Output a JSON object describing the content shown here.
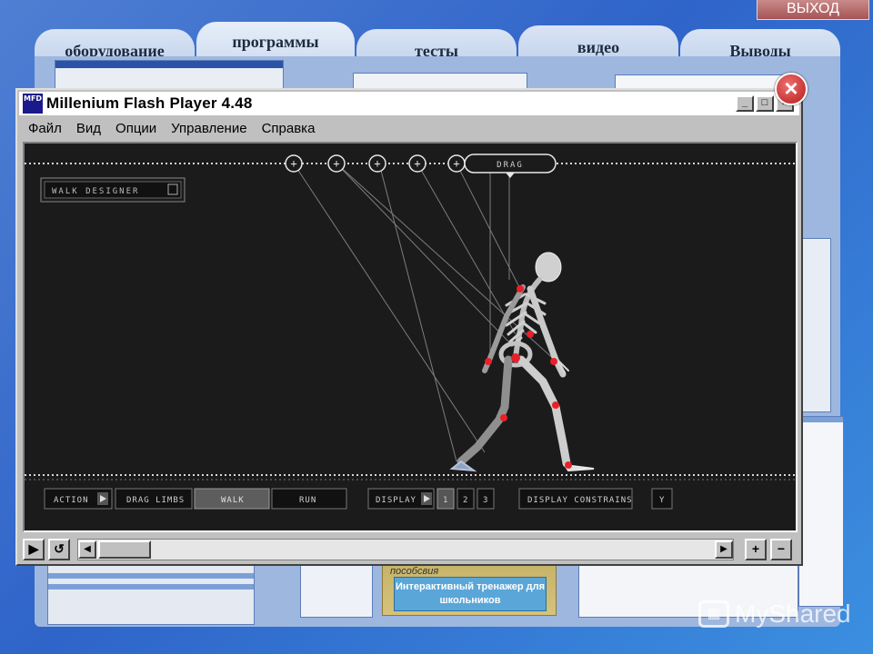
{
  "exit": {
    "label": "ВЫХОД"
  },
  "tabs": [
    {
      "label": "оборудование"
    },
    {
      "label": "программы"
    },
    {
      "label": "тесты"
    },
    {
      "label": "видео"
    },
    {
      "label": "Выводы"
    }
  ],
  "window": {
    "icon_text": "MFD",
    "title": "Millenium Flash Player 4.48",
    "minimize": "_",
    "maximize": "□",
    "close": "×",
    "menu": [
      "Файл",
      "Вид",
      "Опции",
      "Управление",
      "Справка"
    ]
  },
  "stage": {
    "designer_label": "WALK DESIGNER",
    "drag_label": "DRAG",
    "controls": {
      "action": "ACTION",
      "drag_limbs": "DRAG LIMBS",
      "walk": "WALK",
      "run": "RUN",
      "display": "DISPLAY",
      "display_1": "1",
      "display_2": "2",
      "display_3": "3",
      "display_constrains": "DISPLAY CONSTRAINS",
      "y": "Y"
    }
  },
  "bottombar": {
    "play": "▶",
    "rewind": "↺",
    "scroll_left": "◀",
    "scroll_right": "▶",
    "zoom_in": "+",
    "zoom_out": "−"
  },
  "background": {
    "trainer_top": "пособсвия",
    "trainer_text": "Интерактивный тренажер для школьников"
  },
  "watermark": {
    "text": "MyShared"
  },
  "colors": {
    "stage_bg": "#1b1b1b",
    "joint_red": "#e8202a",
    "tab_bg": "#d9e4f4",
    "exit_bg": "#b56a6a"
  }
}
